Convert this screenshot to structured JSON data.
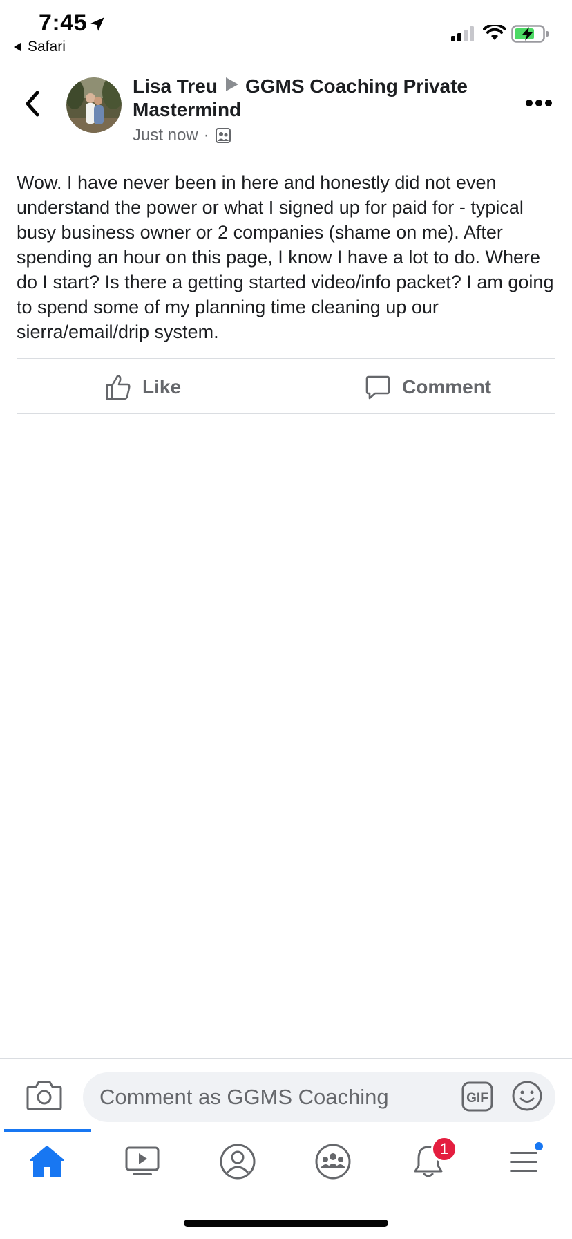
{
  "status_bar": {
    "time": "7:45",
    "back_app": "Safari",
    "icons": [
      "location-arrow-icon",
      "signal-icon",
      "wifi-icon",
      "battery-charging-icon"
    ]
  },
  "post": {
    "author": "Lisa Treu",
    "group": "GGMS Coaching Private Mastermind",
    "timestamp": "Just now",
    "separator": "·",
    "privacy_icon": "group-members-icon",
    "text": "Wow. I have never been in here and honestly did not even understand the power or what I signed up for paid for - typical busy business owner or 2 companies (shame on me). After spending an hour on this page, I know I have a lot to do. Where do I start? Is there a getting started video/info packet? I am going to spend some of my planning time cleaning up our sierra/email/drip system."
  },
  "actions": {
    "like_label": "Like",
    "comment_label": "Comment"
  },
  "composer": {
    "placeholder": "Comment as GGMS Coaching"
  },
  "tab_bar": {
    "tabs": [
      "home-icon",
      "watch-icon",
      "profile-icon",
      "groups-icon",
      "notifications-icon",
      "menu-icon"
    ],
    "active": "home",
    "notification_count": "1",
    "accent_color": "#1877f2",
    "badge_color": "#e41e3f"
  }
}
